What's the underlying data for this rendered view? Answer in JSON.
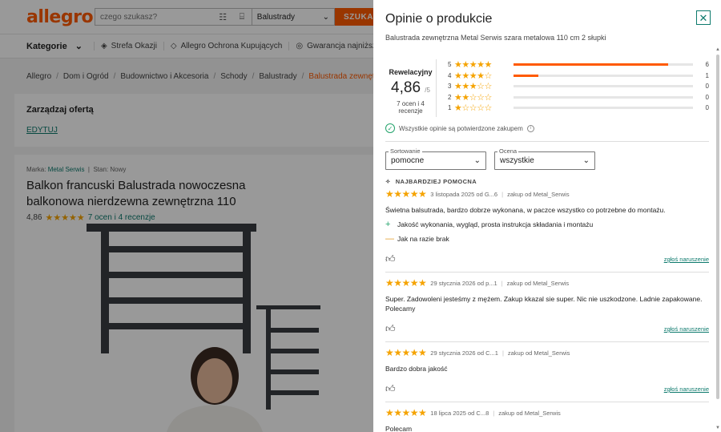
{
  "header": {
    "logo": "allegro",
    "search_placeholder": "czego szukasz?",
    "search_category": "Balustrady",
    "search_button": "SZUKAJ"
  },
  "nav": {
    "categories": "Kategorie",
    "links": [
      "Strefa Okazji",
      "Allegro Ochrona Kupujących",
      "Gwarancja najniższej ceny"
    ]
  },
  "breadcrumb": [
    "Allegro",
    "Dom i Ogród",
    "Budownictwo i Akcesoria",
    "Schody",
    "Balustrady",
    "Balustrada zewnętrzna Metal Serwis sza"
  ],
  "manage": {
    "title": "Zarządzaj ofertą",
    "edit": "EDYTUJ"
  },
  "product": {
    "brand_label": "Marka:",
    "brand": "Metal Serwis",
    "state_label": "Stan:",
    "state": "Nowy",
    "title": "Balkon francuski Balustrada nowoczesna balkonowa nierdzewna zewnętrzna 110",
    "rating": "4,86",
    "rating_stars": "★★★★★",
    "rating_link": "7 ocen i 4 recenzje"
  },
  "drawer": {
    "title": "Opinie o produkcie",
    "subtitle": "Balustrada zewnętrzna Metal Serwis szara metalowa 110 cm 2 słupki",
    "summary": {
      "label": "Rewelacyjny",
      "score": "4,86",
      "max": "/5",
      "count": "7 ocen i 4 recenzje"
    },
    "distribution": [
      {
        "stars": "5",
        "glyphs": "★★★★★",
        "count": "6",
        "fraction": 0.86
      },
      {
        "stars": "4",
        "glyphs": "★★★★☆",
        "count": "1",
        "fraction": 0.14
      },
      {
        "stars": "3",
        "glyphs": "★★★☆☆",
        "count": "0",
        "fraction": 0
      },
      {
        "stars": "2",
        "glyphs": "★★☆☆☆",
        "count": "0",
        "fraction": 0
      },
      {
        "stars": "1",
        "glyphs": "★☆☆☆☆",
        "count": "0",
        "fraction": 0
      }
    ],
    "verified_text": "Wszystkie opinie są potwierdzone zakupem",
    "filters": {
      "sort_label": "Sortowanie",
      "sort_value": "pomocne",
      "rating_label": "Ocena",
      "rating_value": "wszystkie"
    },
    "most_helpful": "NAJBARDZIEJ POMOCNA",
    "report_label": "zgłoś naruszenie",
    "reviews": [
      {
        "stars": "★★★★★",
        "date": "3 listopada 2025 od G...6",
        "purchase": "zakup od Metal_Serwis",
        "text": "Świetna balsutrada, bardzo dobrze wykonana, w paczce wszystko co potrzebne do montażu.",
        "pro": "Jakość wykonania, wygląd, prosta instrukcja składania i montażu",
        "con": "Jak na razie brak"
      },
      {
        "stars": "★★★★★",
        "date": "29 stycznia 2026 od p...1",
        "purchase": "zakup od Metal_Serwis",
        "text": "Super. Zadowoleni jesteśmy z mężem. Zakup kkazal sie super. Nic nie uszkodzone. Ladnie zapakowane. Polecamy"
      },
      {
        "stars": "★★★★★",
        "date": "29 stycznia 2026 od C...1",
        "purchase": "zakup od Metal_Serwis",
        "text": "Bardzo dobra jakość"
      },
      {
        "stars": "★★★★★",
        "date": "18 lipca 2025 od C...8",
        "purchase": "zakup od Metal_Serwis",
        "text": "Polecam"
      }
    ]
  }
}
